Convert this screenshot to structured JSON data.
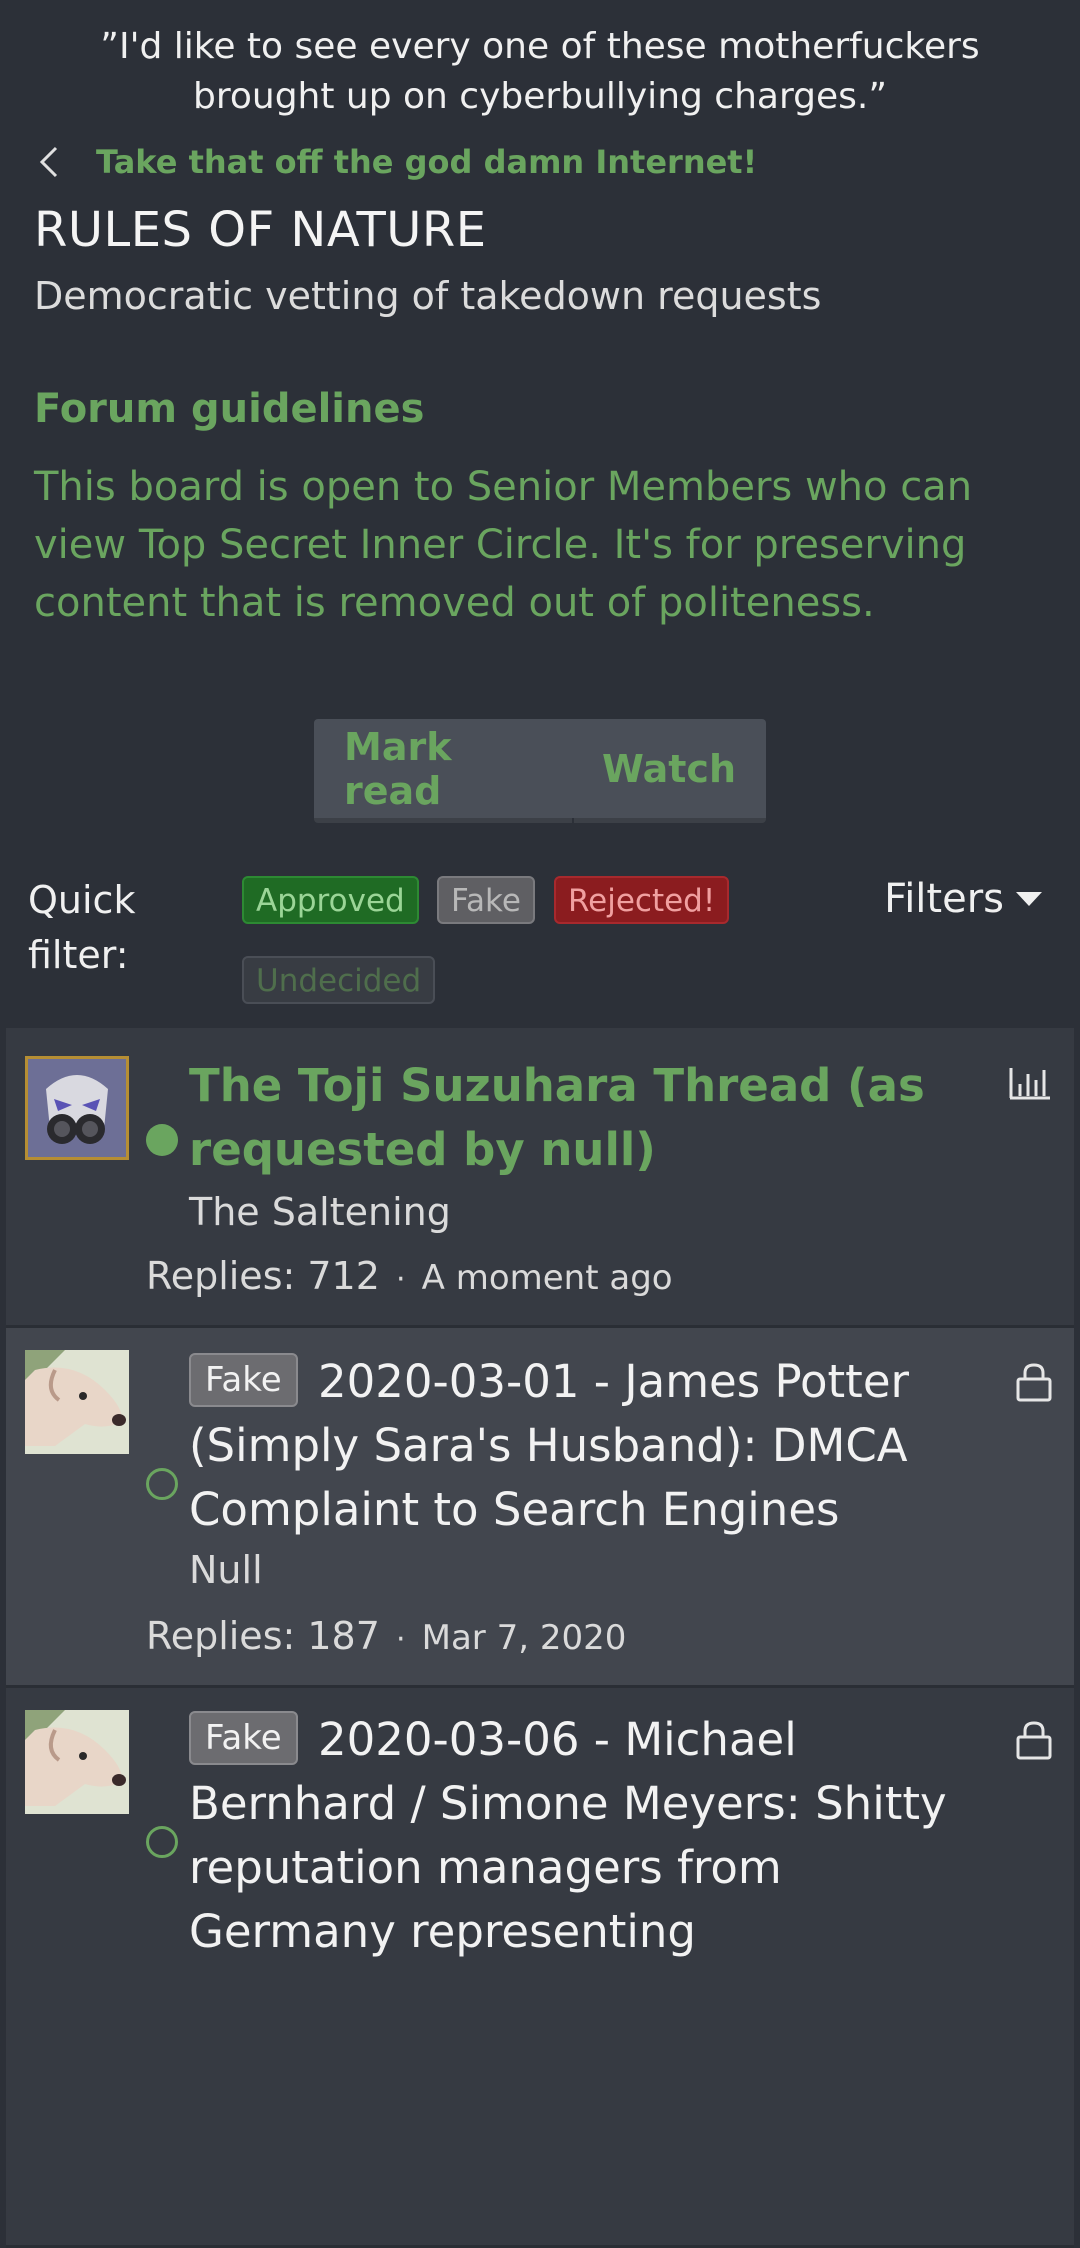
{
  "header": {
    "quote": "”I'd like to see every one of these motherfuckers brought up on cyberbullying charges.”",
    "breadcrumb": "Take that off the god damn Internet!",
    "title": "RULES OF NATURE",
    "description": "Democratic vetting of takedown requests"
  },
  "guidelines": {
    "title": "Forum guidelines",
    "body": "This board is open to Senior Members who can view Top Secret Inner Circle. It's for preserving content that is removed out of politeness."
  },
  "actions": {
    "mark_read": "Mark read",
    "watch": "Watch"
  },
  "filter": {
    "label": "Quick filter:",
    "chips": [
      "Approved",
      "Fake",
      "Rejected!",
      "Undecided"
    ],
    "filters_label": "Filters"
  },
  "threads": [
    {
      "title": "The Toji Suzuhara Thread (as requested by null)",
      "starter": "The Saltening",
      "replies": "Replies: 712",
      "time": "A moment ago",
      "icon": "chart-icon",
      "unread": true
    },
    {
      "prefix": "Fake",
      "title": "2020-03-01 - James Potter (Simply Sara's Husband): DMCA Complaint to Search Engines",
      "starter": "Null",
      "replies": "Replies: 187",
      "time": "Mar 7, 2020",
      "icon": "lock-icon",
      "unread": false
    },
    {
      "prefix": "Fake",
      "title": "2020-03-06 - Michael Bernhard / Simone Meyers: Shitty reputation managers from Germany representing",
      "icon": "lock-icon",
      "unread": false
    }
  ],
  "colors": {
    "accent": "#6aa55f",
    "background": "#2c3038",
    "approved": "#1f6b24",
    "rejected": "#8b1c1f"
  }
}
